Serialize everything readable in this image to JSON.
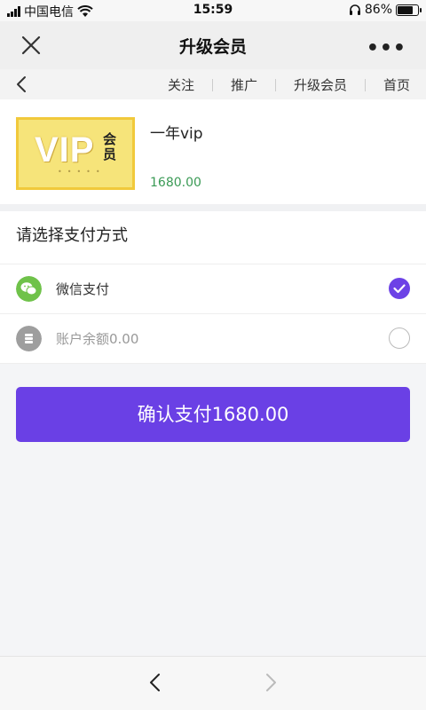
{
  "status": {
    "carrier": "中国电信",
    "time": "15:59",
    "battery": "86%",
    "battery_level": 0.86
  },
  "header": {
    "title": "升级会员",
    "close_icon": "close-icon",
    "more": "•••"
  },
  "nav": {
    "links": [
      "关注",
      "推广",
      "升级会员",
      "首页"
    ]
  },
  "product": {
    "badge_text": "VIP",
    "badge_side": "会员",
    "name": "一年vip",
    "price": "1680.00"
  },
  "payment": {
    "title": "请选择支付方式",
    "options": [
      {
        "label": "微信支付",
        "selected": true,
        "color": "#6fc24a"
      },
      {
        "label": "账户余额0.00",
        "selected": false,
        "color": "#9e9e9e"
      }
    ]
  },
  "confirm": {
    "label": "确认支付1680.00"
  },
  "colors": {
    "accent": "#6a40e5",
    "price": "#3a9a55"
  }
}
